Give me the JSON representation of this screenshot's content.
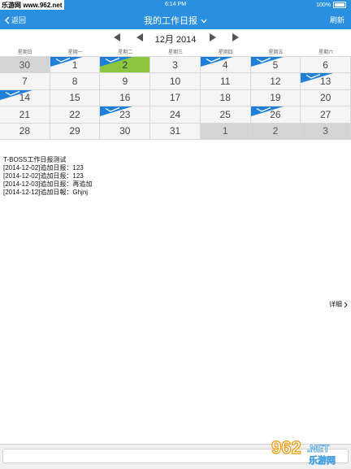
{
  "status_bar": {
    "time": "6:14 PM",
    "battery": "100%",
    "watermark": "乐游网 www.962.net"
  },
  "nav": {
    "back_label": "返回",
    "title": "我的工作日报",
    "refresh_label": "刷新"
  },
  "calendar": {
    "month_label": "12月 2014",
    "weekdays": [
      "星期日",
      "星期一",
      "星期二",
      "星期三",
      "星期四",
      "星期五",
      "星期六"
    ],
    "days": [
      {
        "n": "30",
        "other": true,
        "flag": false,
        "today": false
      },
      {
        "n": "1",
        "other": false,
        "flag": true,
        "today": false
      },
      {
        "n": "2",
        "other": false,
        "flag": true,
        "today": true
      },
      {
        "n": "3",
        "other": false,
        "flag": false,
        "today": false
      },
      {
        "n": "4",
        "other": false,
        "flag": true,
        "today": false
      },
      {
        "n": "5",
        "other": false,
        "flag": true,
        "today": false
      },
      {
        "n": "6",
        "other": false,
        "flag": false,
        "today": false
      },
      {
        "n": "7",
        "other": false,
        "flag": false,
        "today": false
      },
      {
        "n": "8",
        "other": false,
        "flag": false,
        "today": false
      },
      {
        "n": "9",
        "other": false,
        "flag": false,
        "today": false
      },
      {
        "n": "10",
        "other": false,
        "flag": false,
        "today": false
      },
      {
        "n": "11",
        "other": false,
        "flag": false,
        "today": false
      },
      {
        "n": "12",
        "other": false,
        "flag": false,
        "today": false
      },
      {
        "n": "13",
        "other": false,
        "flag": true,
        "today": false
      },
      {
        "n": "14",
        "other": false,
        "flag": true,
        "today": false
      },
      {
        "n": "15",
        "other": false,
        "flag": false,
        "today": false
      },
      {
        "n": "16",
        "other": false,
        "flag": false,
        "today": false
      },
      {
        "n": "17",
        "other": false,
        "flag": false,
        "today": false
      },
      {
        "n": "18",
        "other": false,
        "flag": false,
        "today": false
      },
      {
        "n": "19",
        "other": false,
        "flag": false,
        "today": false
      },
      {
        "n": "20",
        "other": false,
        "flag": false,
        "today": false
      },
      {
        "n": "21",
        "other": false,
        "flag": false,
        "today": false
      },
      {
        "n": "22",
        "other": false,
        "flag": false,
        "today": false
      },
      {
        "n": "23",
        "other": false,
        "flag": true,
        "today": false
      },
      {
        "n": "24",
        "other": false,
        "flag": false,
        "today": false
      },
      {
        "n": "25",
        "other": false,
        "flag": false,
        "today": false
      },
      {
        "n": "26",
        "other": false,
        "flag": true,
        "today": false
      },
      {
        "n": "27",
        "other": false,
        "flag": false,
        "today": false
      },
      {
        "n": "28",
        "other": false,
        "flag": false,
        "today": false
      },
      {
        "n": "29",
        "other": false,
        "flag": false,
        "today": false
      },
      {
        "n": "30",
        "other": false,
        "flag": false,
        "today": false
      },
      {
        "n": "31",
        "other": false,
        "flag": false,
        "today": false
      },
      {
        "n": "1",
        "other": true,
        "flag": false,
        "today": false
      },
      {
        "n": "2",
        "other": true,
        "flag": false,
        "today": false
      },
      {
        "n": "3",
        "other": true,
        "flag": false,
        "today": false
      }
    ]
  },
  "report": {
    "lines": [
      "T-BOSS工作日报测试",
      "[2014-12-02]追加日报：123",
      "[2014-12-02]追加日报：123",
      "[2014-12-03]追加日报：再追加",
      "[2014-12-12]追加日報：Ghjnj"
    ],
    "detail_label": "详细"
  },
  "colors": {
    "accent": "#2b8fe0",
    "today_bg": "#8cc63f",
    "flag_blue": "#1e7fd8",
    "other_month_bg": "#d4d4d4"
  },
  "watermark_bottom": {
    "brand": "962",
    "suffix": ".NET",
    "cn": "乐游网"
  }
}
